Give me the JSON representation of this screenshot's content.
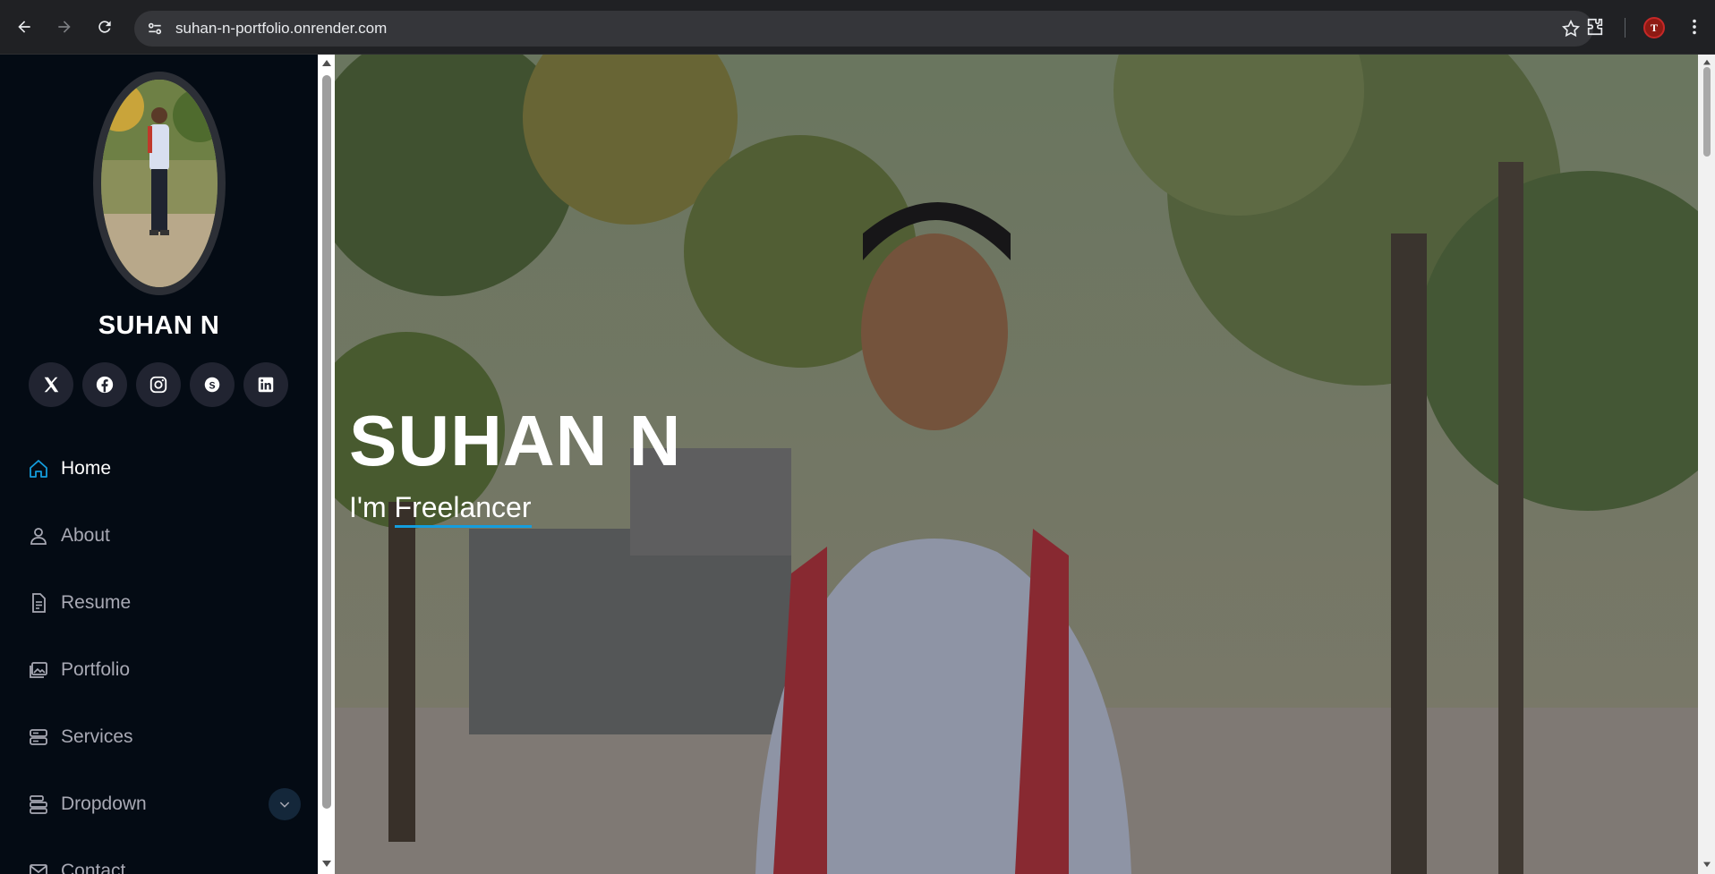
{
  "browser": {
    "url": "suhan-n-portfolio.onrender.com",
    "profile_initial": "T"
  },
  "sidebar": {
    "name": "SUHAN N",
    "socials": [
      "x-twitter-icon",
      "facebook-icon",
      "instagram-icon",
      "skype-icon",
      "linkedin-icon"
    ],
    "nav": [
      {
        "label": "Home",
        "icon": "house-icon",
        "active": true
      },
      {
        "label": "About",
        "icon": "person-icon",
        "active": false
      },
      {
        "label": "Resume",
        "icon": "file-text-icon",
        "active": false
      },
      {
        "label": "Portfolio",
        "icon": "images-icon",
        "active": false
      },
      {
        "label": "Services",
        "icon": "server-icon",
        "active": false
      },
      {
        "label": "Dropdown",
        "icon": "menu-icon",
        "active": false
      },
      {
        "label": "Contact",
        "icon": "envelope-icon",
        "active": false
      }
    ]
  },
  "hero": {
    "title": "SUHAN N",
    "prefix": "I'm",
    "typed": "Freelancer"
  },
  "colors": {
    "accent": "#149ddd",
    "sidebar_bg": "#040b14"
  }
}
